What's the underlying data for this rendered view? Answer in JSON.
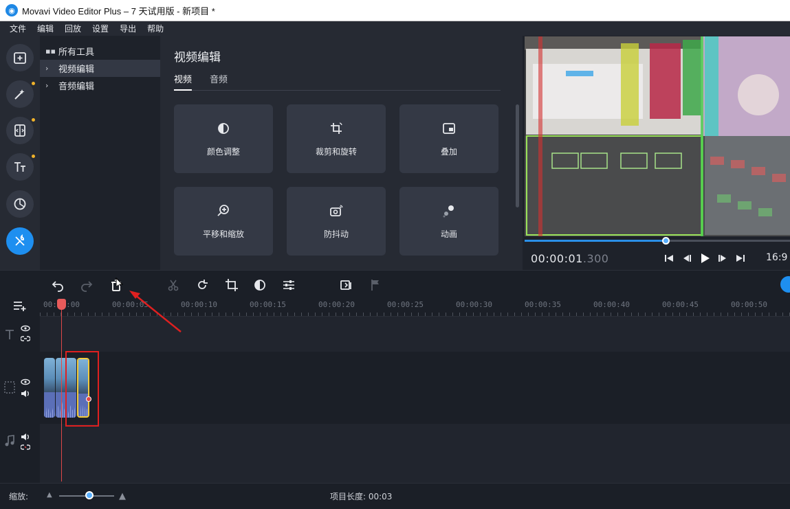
{
  "window": {
    "title": "Movavi Video Editor Plus – 7 天试用版 - 新项目 *",
    "logo_icon": "movavi-logo-icon"
  },
  "menu": [
    "文件",
    "编辑",
    "回放",
    "设置",
    "导出",
    "帮助"
  ],
  "rail": [
    {
      "name": "import-icon",
      "dot": false,
      "active": false
    },
    {
      "name": "magic-wand-icon",
      "dot": true,
      "active": false
    },
    {
      "name": "transition-icon",
      "dot": true,
      "active": false
    },
    {
      "name": "titles-icon",
      "dot": true,
      "active": false
    },
    {
      "name": "stickers-icon",
      "dot": false,
      "active": false
    },
    {
      "name": "tools-icon",
      "dot": false,
      "active": true
    }
  ],
  "tree": {
    "all_tools": "所有工具",
    "video_edit": "视频编辑",
    "audio_edit": "音频编辑"
  },
  "panel": {
    "title": "视频编辑",
    "tabs": [
      "视频",
      "音频"
    ],
    "tiles": [
      "颜色调整",
      "裁剪和旋转",
      "叠加",
      "平移和缩放",
      "防抖动",
      "动画"
    ]
  },
  "preview": {
    "timecode_main": "00:00:01",
    "timecode_ms": ".300",
    "aspect": "16:9",
    "progress": 0.53
  },
  "ruler": {
    "labels": [
      "00:00:00",
      "00:00:05",
      "00:00:10",
      "00:00:15",
      "00:00:20",
      "00:00:25",
      "00:00:30",
      "00:00:35",
      "00:00:40",
      "00:00:45",
      "00:00:50"
    ]
  },
  "status": {
    "zoom_label": "缩放:",
    "duration": "项目长度: 00:03",
    "zoom_level": 0.55
  },
  "colors": {
    "accent": "#1e8ff0",
    "playhead": "#e04848",
    "highlight_box": "#e02020",
    "selected_clip": "#f4cc3c"
  }
}
